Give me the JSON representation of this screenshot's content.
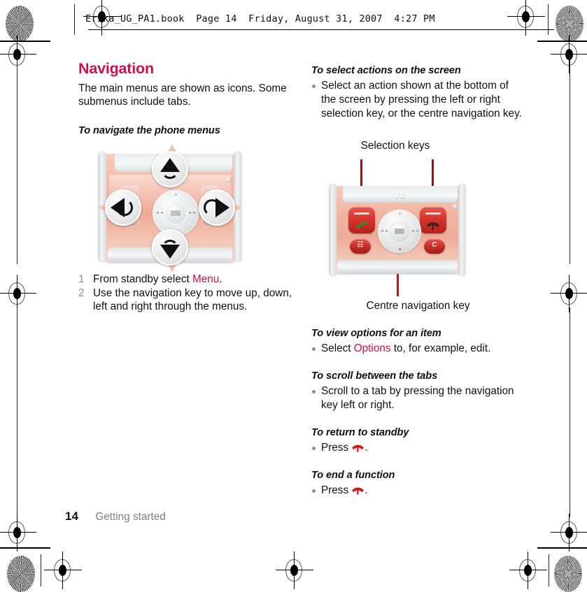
{
  "header": {
    "text": "Erika_UG_PA1.book  Page 14  Friday, August 31, 2007  4:27 PM"
  },
  "colors": {
    "accent": "#CE0E4E",
    "body_text": "#111111",
    "muted": "#8d8d8d",
    "phone_body": "#EEAB97",
    "key_red": "#C5302A",
    "leader_line": "#9E1212"
  },
  "left_column": {
    "section_title": "Navigation",
    "intro": "The main menus are shown as icons. Some submenus include tabs.",
    "task_title": "To navigate the phone menus",
    "steps": [
      {
        "n": "1",
        "text_before": "From standby select ",
        "accent": "Menu",
        "text_after": "."
      },
      {
        "n": "2",
        "text_before": "Use the navigation key to move up, down, left and right through the menus.",
        "accent": "",
        "text_after": ""
      }
    ]
  },
  "right_column": {
    "task_select_title": "To select actions on the screen",
    "task_select_bullet": "Select an action shown at the bottom of the screen by pressing the left or right selection key, or the centre navigation key.",
    "illustration_caption_top": "Selection keys",
    "illustration_caption_bottom": "Centre navigation key",
    "task_options_title": "To view options for an item",
    "task_options_before": "Select ",
    "task_options_accent": "Options",
    "task_options_after": " to, for example, edit.",
    "task_scroll_title": "To scroll between the tabs",
    "task_scroll_bullet": "Scroll to a tab by pressing the navigation key left or right.",
    "task_standby_title": "To return to standby",
    "task_standby_before": "Press ",
    "task_standby_after": ".",
    "task_end_title": "To end a function",
    "task_end_before": "Press ",
    "task_end_after": "."
  },
  "illustration_1": {
    "name": "phone-navigation-keys-diagram",
    "walkman_logo": "",
    "callouts": [
      "up-arrow",
      "left-arrow",
      "right-arrow",
      "down-arrow"
    ]
  },
  "illustration_2": {
    "name": "phone-selection-keys-diagram",
    "walkman_logo": "W.",
    "clear_key_label": "C"
  },
  "icons": {
    "end_call": "end-call-handset-icon",
    "call": "call-handset-icon",
    "clear": "clear-key-icon",
    "activity": "activity-menu-icon"
  },
  "footer": {
    "page_number": "14",
    "chapter": "Getting started"
  }
}
